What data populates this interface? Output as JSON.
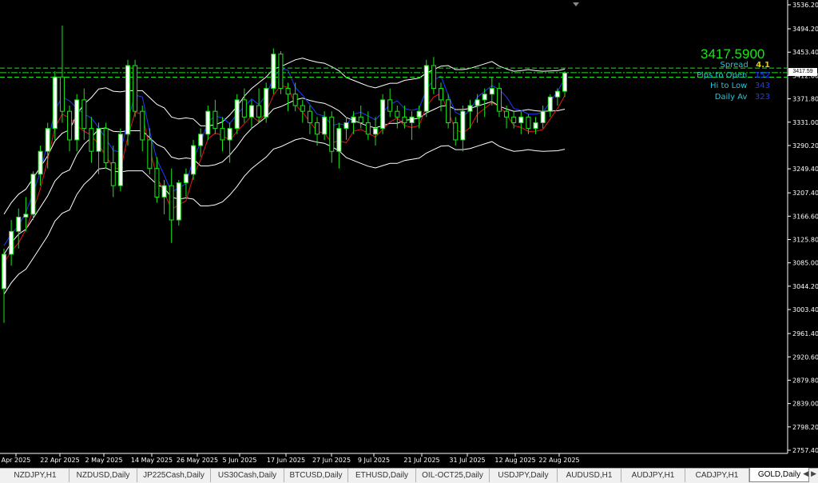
{
  "chart": {
    "symbol_timeframe": "GOLD,Daily",
    "current_price": "3417.5900",
    "price_tag": "3417.59"
  },
  "indicators": {
    "spread_label": "Spread",
    "spread_value": "4.1",
    "pips_label": "Pips to Open",
    "pips_value": "152",
    "hilo_label": "Hi to Low",
    "hilo_value": "343",
    "dailyav_label": "Daily Av",
    "dailyav_value": "323"
  },
  "colors": {
    "bull_candle": "#ffffff",
    "bear_candle": "#000000",
    "wick": "#19e619",
    "price_line": "#19e619",
    "ma_red": "#e11919",
    "ma_blue": "#1e3cff",
    "bands": "#ffffff"
  },
  "tabs": [
    {
      "label": "NZDJPY,H1",
      "active": false
    },
    {
      "label": "NZDUSD,Daily",
      "active": false
    },
    {
      "label": "JP225Cash,Daily",
      "active": false
    },
    {
      "label": "US30Cash,Daily",
      "active": false
    },
    {
      "label": "BTCUSD,Daily",
      "active": false
    },
    {
      "label": "ETHUSD,Daily",
      "active": false
    },
    {
      "label": "OIL-OCT25,Daily",
      "active": false
    },
    {
      "label": "USDJPY,Daily",
      "active": false
    },
    {
      "label": "AUDUSD,H1",
      "active": false
    },
    {
      "label": "AUDJPY,H1",
      "active": false
    },
    {
      "label": "CADJPY,H1",
      "active": false
    },
    {
      "label": "GOLD,Daily",
      "active": true
    }
  ],
  "chart_data": {
    "type": "candlestick",
    "y_ticks": [
      "3536.20",
      "3494.20",
      "3453.40",
      "3412.60",
      "3371.80",
      "3331.00",
      "3290.20",
      "3249.40",
      "3207.40",
      "3166.60",
      "3125.80",
      "3085.00",
      "3044.20",
      "3003.40",
      "2961.40",
      "2920.60",
      "2879.80",
      "2839.00",
      "2798.20",
      "2757.40"
    ],
    "x_ticks": [
      "Apr 2025",
      "22 Apr 2025",
      "2 May 2025",
      "14 May 2025",
      "26 May 2025",
      "5 Jun 2025",
      "17 Jun 2025",
      "27 Jun 2025",
      "9 Jul 2025",
      "21 Jul 2025",
      "31 Jul 2025",
      "12 Aug 2025",
      "22 Aug 2025"
    ],
    "ylim": [
      2757.4,
      3536.2
    ],
    "candles": [
      [
        3040,
        3110,
        2980,
        3100
      ],
      [
        3100,
        3160,
        3080,
        3140
      ],
      [
        3140,
        3180,
        3110,
        3165
      ],
      [
        3165,
        3200,
        3140,
        3170
      ],
      [
        3170,
        3245,
        3160,
        3240
      ],
      [
        3240,
        3290,
        3220,
        3280
      ],
      [
        3280,
        3330,
        3250,
        3320
      ],
      [
        3320,
        3420,
        3300,
        3410
      ],
      [
        3410,
        3500,
        3330,
        3350
      ],
      [
        3350,
        3360,
        3280,
        3300
      ],
      [
        3300,
        3380,
        3280,
        3370
      ],
      [
        3370,
        3390,
        3300,
        3320
      ],
      [
        3320,
        3340,
        3260,
        3280
      ],
      [
        3280,
        3330,
        3240,
        3320
      ],
      [
        3320,
        3330,
        3250,
        3260
      ],
      [
        3260,
        3290,
        3200,
        3220
      ],
      [
        3220,
        3320,
        3210,
        3310
      ],
      [
        3310,
        3440,
        3290,
        3430
      ],
      [
        3430,
        3440,
        3340,
        3350
      ],
      [
        3350,
        3360,
        3280,
        3300
      ],
      [
        3300,
        3320,
        3240,
        3250
      ],
      [
        3250,
        3270,
        3190,
        3200
      ],
      [
        3200,
        3230,
        3170,
        3220
      ],
      [
        3220,
        3250,
        3120,
        3160
      ],
      [
        3160,
        3230,
        3150,
        3225
      ],
      [
        3225,
        3250,
        3200,
        3240
      ],
      [
        3240,
        3300,
        3230,
        3290
      ],
      [
        3290,
        3320,
        3270,
        3310
      ],
      [
        3310,
        3360,
        3300,
        3350
      ],
      [
        3350,
        3370,
        3310,
        3320
      ],
      [
        3320,
        3340,
        3280,
        3300
      ],
      [
        3300,
        3330,
        3260,
        3320
      ],
      [
        3320,
        3380,
        3310,
        3370
      ],
      [
        3370,
        3390,
        3330,
        3340
      ],
      [
        3340,
        3370,
        3320,
        3360
      ],
      [
        3360,
        3390,
        3330,
        3340
      ],
      [
        3340,
        3400,
        3330,
        3390
      ],
      [
        3390,
        3460,
        3380,
        3450
      ],
      [
        3450,
        3455,
        3380,
        3390
      ],
      [
        3390,
        3400,
        3350,
        3380
      ],
      [
        3380,
        3400,
        3350,
        3360
      ],
      [
        3360,
        3370,
        3330,
        3350
      ],
      [
        3350,
        3360,
        3310,
        3330
      ],
      [
        3330,
        3340,
        3290,
        3310
      ],
      [
        3310,
        3350,
        3300,
        3340
      ],
      [
        3340,
        3350,
        3260,
        3280
      ],
      [
        3280,
        3330,
        3250,
        3320
      ],
      [
        3320,
        3340,
        3300,
        3330
      ],
      [
        3330,
        3350,
        3310,
        3340
      ],
      [
        3340,
        3360,
        3320,
        3330
      ],
      [
        3330,
        3350,
        3300,
        3310
      ],
      [
        3310,
        3340,
        3290,
        3320
      ],
      [
        3320,
        3380,
        3310,
        3370
      ],
      [
        3370,
        3390,
        3340,
        3350
      ],
      [
        3350,
        3360,
        3320,
        3340
      ],
      [
        3340,
        3360,
        3320,
        3330
      ],
      [
        3330,
        3350,
        3300,
        3340
      ],
      [
        3340,
        3360,
        3320,
        3350
      ],
      [
        3350,
        3440,
        3340,
        3430
      ],
      [
        3430,
        3445,
        3380,
        3390
      ],
      [
        3390,
        3400,
        3350,
        3370
      ],
      [
        3370,
        3380,
        3320,
        3330
      ],
      [
        3330,
        3340,
        3290,
        3300
      ],
      [
        3300,
        3360,
        3280,
        3350
      ],
      [
        3350,
        3370,
        3320,
        3360
      ],
      [
        3360,
        3380,
        3330,
        3370
      ],
      [
        3370,
        3390,
        3340,
        3380
      ],
      [
        3380,
        3410,
        3360,
        3390
      ],
      [
        3390,
        3400,
        3340,
        3350
      ],
      [
        3350,
        3360,
        3320,
        3340
      ],
      [
        3340,
        3350,
        3320,
        3330
      ],
      [
        3330,
        3350,
        3310,
        3340
      ],
      [
        3340,
        3345,
        3310,
        3320
      ],
      [
        3320,
        3340,
        3310,
        3330
      ],
      [
        3330,
        3360,
        3320,
        3350
      ],
      [
        3350,
        3380,
        3340,
        3375
      ],
      [
        3375,
        3390,
        3360,
        3385
      ],
      [
        3385,
        3420,
        3375,
        3417
      ]
    ]
  }
}
